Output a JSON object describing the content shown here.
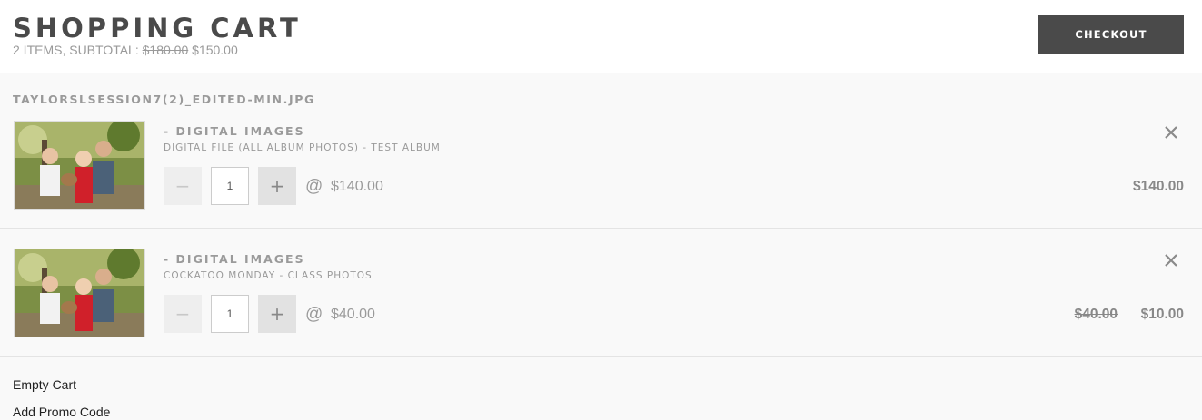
{
  "header": {
    "title": "SHOPPING CART",
    "summary_prefix": "2 ITEMS, SUBTOTAL:",
    "subtotal_original": "$180.00",
    "subtotal_current": "$150.00",
    "checkout_label": "CHECKOUT"
  },
  "file_name": "TAYLORSLSESSION7(2)_EDITED-MIN.JPG",
  "items": [
    {
      "category": "- DIGITAL IMAGES",
      "description": "DIGITAL FILE (ALL ALBUM PHOTOS) - TEST ALBUM",
      "minus": "−",
      "quantity": "1",
      "plus": "+",
      "at": "@",
      "unit_price": "$140.00",
      "total": "$140.00"
    },
    {
      "category": "- DIGITAL IMAGES",
      "description": "COCKATOO MONDAY - CLASS PHOTOS",
      "minus": "−",
      "quantity": "1",
      "plus": "+",
      "at": "@",
      "unit_price": "$40.00",
      "original_total": "$40.00",
      "total": "$10.00"
    }
  ],
  "links": {
    "empty_cart": "Empty Cart",
    "add_promo": "Add Promo Code"
  },
  "colors": {
    "checkout_bg": "#4a4a4a",
    "muted_text": "#9a9a9a"
  },
  "icons": {
    "remove": "close-icon"
  }
}
